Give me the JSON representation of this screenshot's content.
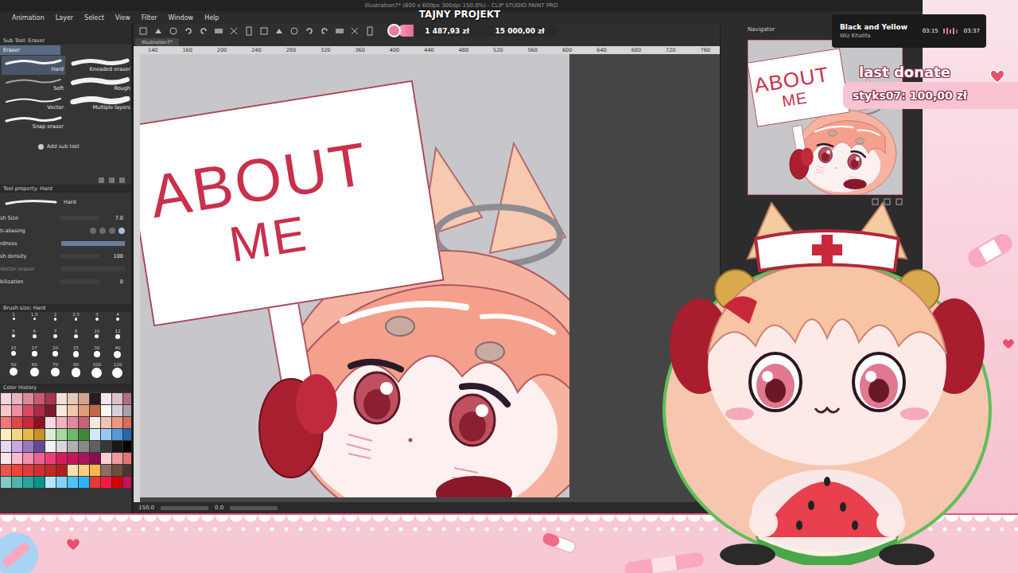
{
  "window": {
    "title": "Illustration7* (600 x 600px 300dpi 150.0%) - CLIP STUDIO PAINT PRO"
  },
  "menu": [
    "Animation",
    "Layer",
    "Select",
    "View",
    "Filter",
    "Window",
    "Help"
  ],
  "sub_tool": {
    "title": "Sub Tool: Eraser",
    "group": "Eraser",
    "items": [
      {
        "label": "Hard",
        "selected": true
      },
      {
        "label": "Kneaded eraser",
        "selected": false
      },
      {
        "label": "Soft",
        "selected": false
      },
      {
        "label": "Rough",
        "selected": false
      },
      {
        "label": "Vector",
        "selected": false
      },
      {
        "label": "Multiple layers",
        "selected": false
      },
      {
        "label": "Snap eraser",
        "selected": false
      }
    ],
    "add": "Add sub tool"
  },
  "tool_property": {
    "title": "Tool property: Hard",
    "preset": "Hard",
    "rows": [
      {
        "label": "sh Size",
        "kind": "value",
        "value": "7.0"
      },
      {
        "label": "ti-aliasing",
        "kind": "steps",
        "level": 1
      },
      {
        "label": "rdness",
        "kind": "slider",
        "level": 1
      },
      {
        "label": "sh density",
        "kind": "value",
        "value": "100"
      },
      {
        "label": "Vector eraser",
        "kind": "option"
      },
      {
        "label": "bilization",
        "kind": "value",
        "value": "0"
      }
    ]
  },
  "brush_size": {
    "title": "Brush size: Hard",
    "sizes": [
      "1",
      "1.5",
      "2",
      "2.5",
      "3",
      "4",
      "5",
      "6",
      "7",
      "8",
      "10",
      "12",
      "15",
      "17",
      "20",
      "25",
      "30",
      "40",
      "50",
      "60",
      "70",
      "80",
      "100",
      "120"
    ]
  },
  "color_history": {
    "title": "Color History",
    "colors": [
      "#f4d6dc",
      "#e8b4bf",
      "#d98a9a",
      "#c45a6e",
      "#a8364c",
      "#f0e0d8",
      "#e6c8b8",
      "#d4a48c",
      "#2a1a1e",
      "#f6e6ea",
      "#e0c0c8",
      "#b07080",
      "#f9c4cc",
      "#ef8ea0",
      "#d94a64",
      "#b02a44",
      "#7a1a2c",
      "#fbe8dc",
      "#f2c6a8",
      "#e09a78",
      "#c06848",
      "#fff4f0",
      "#d8d0d8",
      "#a8a0b0",
      "#f07878",
      "#e04848",
      "#c82838",
      "#901020",
      "#fcd8e0",
      "#f8b0c0",
      "#e888a0",
      "#c86078",
      "#fde8e0",
      "#f4c0b0",
      "#ec9880",
      "#d87060",
      "#f8f0c0",
      "#f0d880",
      "#e8b848",
      "#c89028",
      "#d8f0d0",
      "#a8d8a0",
      "#70b868",
      "#408838",
      "#d0e8f8",
      "#98c8f0",
      "#5898d8",
      "#2868a8",
      "#e8d8f0",
      "#c8a8e0",
      "#9878c0",
      "#684898",
      "#f4f4f4",
      "#d8d8d8",
      "#b0b0b0",
      "#888888",
      "#606060",
      "#383838",
      "#181818",
      "#000000",
      "#fce4ec",
      "#f8bbd0",
      "#f48fb1",
      "#f06292",
      "#ec407a",
      "#d81b60",
      "#c2185b",
      "#ad1457",
      "#880e4f",
      "#ffcdd2",
      "#ef9a9a",
      "#e57373",
      "#ef5350",
      "#f44336",
      "#e53935",
      "#d32f2f",
      "#c62828",
      "#b71c1c",
      "#ffe0b2",
      "#ffcc80",
      "#ffb74d",
      "#8d6e63",
      "#6d4c41",
      "#4e342e",
      "#80cbc4",
      "#4db6ac",
      "#26a69a",
      "#009688",
      "#b3e5fc",
      "#81d4fa",
      "#4fc3f7",
      "#29b6f6",
      "#e53935",
      "#ff1744",
      "#d50000",
      "#c51162"
    ]
  },
  "canvas": {
    "tab": "Illustration7*",
    "ruler": [
      "140",
      "160",
      "200",
      "240",
      "280",
      "320",
      "360",
      "400",
      "440",
      "480",
      "520",
      "560",
      "600",
      "640",
      "680",
      "720",
      "760"
    ],
    "sign_lines": [
      "ABOUT",
      "ME"
    ],
    "zoom": "150.0",
    "angle": "0.0"
  },
  "navigator": {
    "title": "Navigator",
    "sign_lines": [
      "ABOUT",
      "ME"
    ]
  },
  "stream": {
    "title": "TAJNY PROJEKT",
    "goal": {
      "current": "1 487,93 zł",
      "target": "15 000,00 zł",
      "level": 0.099
    },
    "now_playing": {
      "track": "Black and Yellow",
      "artist": "Wiz Khalifa",
      "elapsed": "03:15",
      "total": "03:37"
    },
    "last_donate": {
      "label": "last donate",
      "entry": "styks07: 100,00 zł"
    }
  }
}
